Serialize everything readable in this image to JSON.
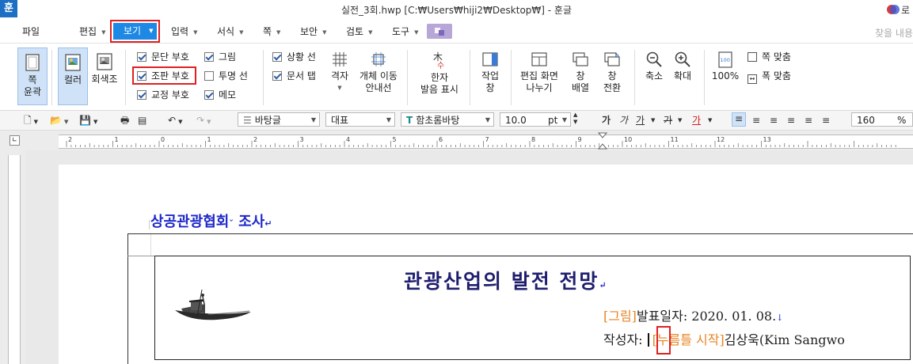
{
  "titlebar": {
    "app_icon": "훈",
    "title": "실전_3회.hwp [C:₩Users₩hiji2₩Desktop₩] - 훈글",
    "user_label": "로"
  },
  "menu": {
    "file": "파일",
    "edit": "편집",
    "view": "보기",
    "input": "입력",
    "format": "서식",
    "page": "쪽",
    "security": "보안",
    "review": "검토",
    "tools": "도구",
    "search_placeholder": "찾을 내용"
  },
  "ribbon": {
    "page_outline": [
      "쪽",
      "윤곽"
    ],
    "color": "컬러",
    "grayscale": "회색조",
    "checkboxes": [
      {
        "label": "문단 부호",
        "checked": true
      },
      {
        "label": "조판 부호",
        "checked": true
      },
      {
        "label": "교정 부호",
        "checked": true
      },
      {
        "label": "그림",
        "checked": true
      },
      {
        "label": "투명 선",
        "checked": false
      },
      {
        "label": "메모",
        "checked": true
      },
      {
        "label": "상황 선",
        "checked": true
      },
      {
        "label": "문서 탭",
        "checked": true
      }
    ],
    "grid": "격자",
    "object_move_guide": [
      "개체 이동",
      "안내선"
    ],
    "hanja_pronunciation": [
      "한자",
      "발음 표시"
    ],
    "work_window": [
      "작업",
      "창"
    ],
    "split_edit_screen": [
      "편집 화면",
      "나누기"
    ],
    "window_arrange": [
      "창",
      "배열"
    ],
    "window_switch": [
      "창",
      "전환"
    ],
    "zoom_out": "축소",
    "zoom_in": "확대",
    "zoom_100": "100%",
    "fit_page": "쪽 맞춤",
    "fit_width": "폭 맞춤"
  },
  "toolbar": {
    "style": "바탕글",
    "lang": "대표",
    "font": "함초롬바탕",
    "size": "10.0",
    "size_unit": "pt",
    "bold_glyph": "가",
    "italic_glyph": "가",
    "underline_glyph": "가",
    "strike_glyph": "가",
    "color_glyph": "가",
    "zoom": "160",
    "zoom_unit": "%"
  },
  "ruler": {
    "h_labels": [
      "2",
      "1",
      "0",
      "1",
      "2",
      "3",
      "4",
      "5",
      "6",
      "7",
      "8",
      "9",
      "10",
      "11",
      "12",
      "13"
    ]
  },
  "document": {
    "heading": "상공관광협회",
    "heading_rest": " 조사",
    "title": "관광산업의 발전 전망",
    "date_field": "[그림]",
    "date_label": "발표일자:",
    "date_value": " 2020. 01. 08.",
    "author_label": "작성자:",
    "author_field": "[누름틀 시작]",
    "author_name": "김상욱(Kim Sangwo"
  },
  "colors": {
    "accent_blue": "#1e88e5",
    "highlight_red": "#e02020",
    "heading_blue": "#1e28c8",
    "field_orange": "#e88422"
  }
}
